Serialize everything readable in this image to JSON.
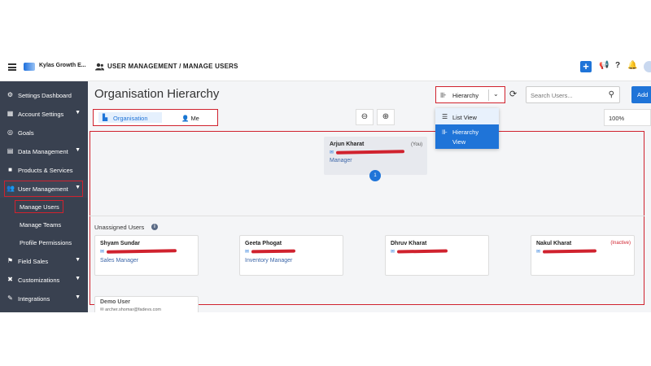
{
  "topbar": {
    "brand": "Kylas Growth E...",
    "breadcrumb": "USER MANAGEMENT / MANAGE USERS",
    "add_symbol": "+"
  },
  "sidebar": {
    "items": [
      {
        "label": "Settings Dashboard",
        "icon": "gear-icon"
      },
      {
        "label": "Account Settings",
        "icon": "account-icon"
      },
      {
        "label": "Goals",
        "icon": "target-icon"
      },
      {
        "label": "Data Management",
        "icon": "data-icon"
      },
      {
        "label": "Products & Services",
        "icon": "box-icon"
      },
      {
        "label": "User Management",
        "icon": "users-icon"
      },
      {
        "label": "Field Sales",
        "icon": "field-icon"
      },
      {
        "label": "Customizations",
        "icon": "wrench-icon"
      },
      {
        "label": "Integrations",
        "icon": "plug-icon"
      }
    ],
    "subitems": [
      "Manage Users",
      "Manage Teams",
      "Profile Permissions"
    ]
  },
  "main": {
    "title": "Organisation Hierarchy",
    "view_select": "Hierarchy",
    "search_placeholder": "Search Users...",
    "add_label": "Add",
    "toggle": {
      "org": "Organisation",
      "me": "Me"
    },
    "zoom": "100%",
    "dropdown": {
      "list_view": "List View",
      "hierarchy_view": "Hierarchy View"
    }
  },
  "hierarchy": {
    "manager": {
      "name": "Arjun Kharat",
      "tag": "(You)",
      "role": "Manager"
    },
    "child_count": "1"
  },
  "unassigned": {
    "title": "Unassigned Users",
    "users": [
      {
        "name": "Shyam Sundar",
        "role": "Sales Manager",
        "status": ""
      },
      {
        "name": "Geeta Phogat",
        "role": "Inventory Manager",
        "status": ""
      },
      {
        "name": "Dhruv Kharat",
        "role": "",
        "status": ""
      },
      {
        "name": "Nakul Kharat",
        "role": "",
        "status": "(Inactive)"
      }
    ],
    "demo": {
      "name": "Demo User",
      "email": "archer.shomar@fadevs.com"
    }
  },
  "colors": {
    "accent": "#1f74d8",
    "sidebar": "#394150",
    "highlight": "#d0222e"
  }
}
